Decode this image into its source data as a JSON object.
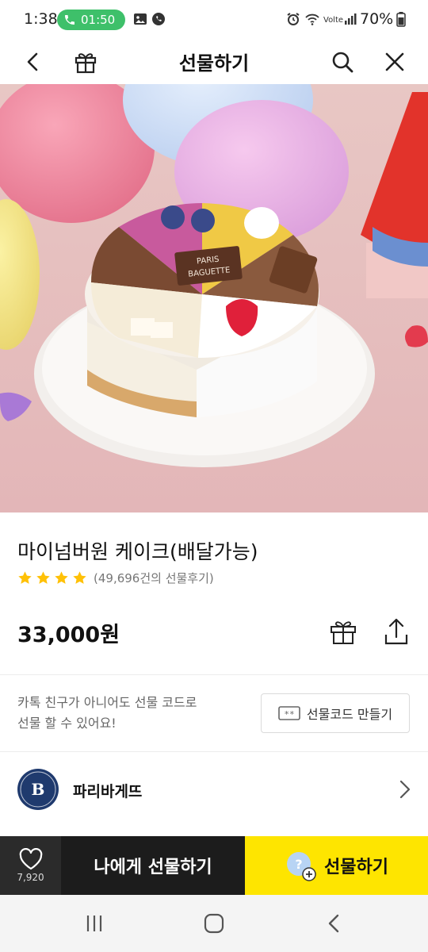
{
  "status_bar": {
    "time": "1:38",
    "call_timer": "01:50",
    "battery": "70%",
    "call_color": "#3ec06a"
  },
  "header": {
    "title": "선물하기",
    "back_icon": "chevron-left-icon",
    "gift_icon": "gift-box-icon",
    "search_icon": "search-icon",
    "close_icon": "close-icon"
  },
  "hero": {
    "image_description_icon": "cake-photo",
    "plaque_text": "PARIS BAGUETTE"
  },
  "product": {
    "name": "마이넘버원 케이크(배달가능)",
    "rating_stars": 4,
    "review_text": "(49,696건의 선물후기)",
    "price": "33,000원",
    "star_color": "#ffc107"
  },
  "gift_code": {
    "description_line1": "카톡 친구가 아니어도 선물 코드로",
    "description_line2": "선물 할 수 있어요!",
    "button_label": "선물코드 만들기",
    "button_icon_text": "**"
  },
  "brand": {
    "name": "파리바게뜨",
    "logo_letter": "B"
  },
  "action_bar": {
    "like_count": "7,920",
    "self_gift_label": "나에게 선물하기",
    "gift_label": "선물하기",
    "gift_bg": "#fee500"
  }
}
